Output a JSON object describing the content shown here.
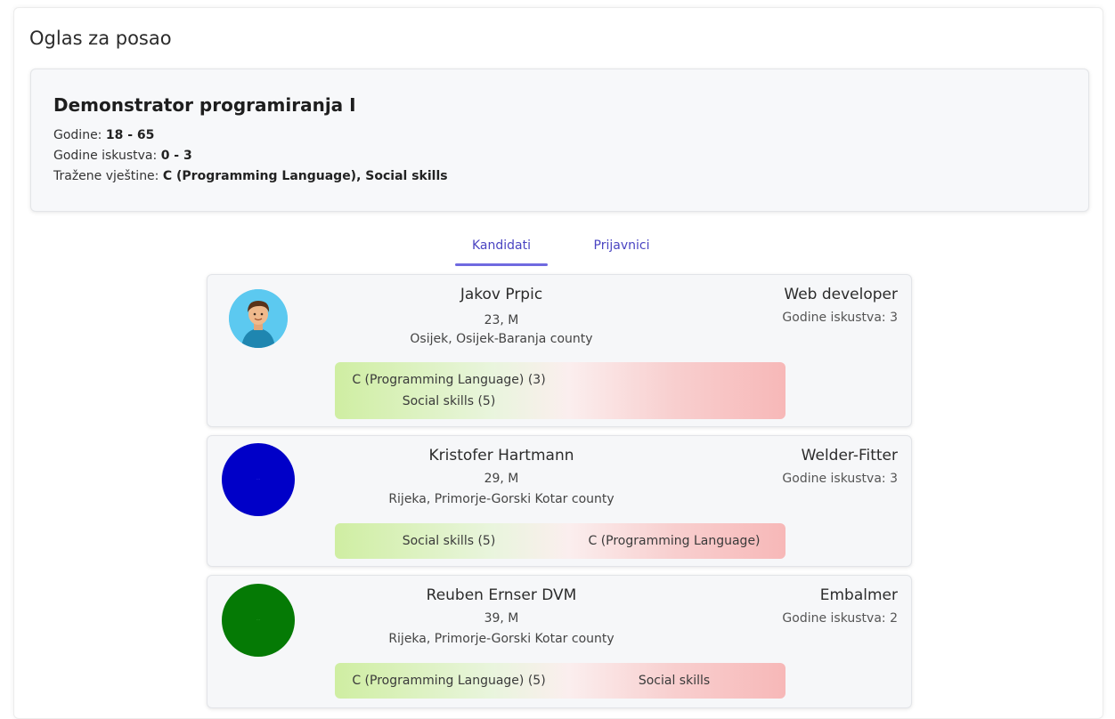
{
  "page": {
    "title": "Oglas za posao"
  },
  "job": {
    "title": "Demonstrator programiranja I",
    "age_label": "Godine:",
    "age_value": "18 - 65",
    "experience_label": "Godine iskustva:",
    "experience_value": "0 - 3",
    "skills_label": "Tražene vještine:",
    "skills_value": "C (Programming Language), Social skills"
  },
  "tabs": [
    {
      "label": "Kandidati",
      "active": true
    },
    {
      "label": "Prijavnici",
      "active": false
    }
  ],
  "candidates": [
    {
      "name": "Jakov Prpic",
      "age_gender": "23, M",
      "location": "Osijek, Osijek-Baranja county",
      "position": "Web developer",
      "experience": "Godine iskustva: 3",
      "avatar": "person-avatar",
      "matched_skills": [
        "C (Programming Language) (3)",
        "Social skills (5)"
      ],
      "missing_skills": []
    },
    {
      "name": "Kristofer Hartmann",
      "age_gender": "29, M",
      "location": "Rijeka, Primorje-Gorski Kotar county",
      "position": "Welder-Fitter",
      "experience": "Godine iskustva: 3",
      "avatar_color": "#0000c8",
      "matched_skills": [
        "Social skills (5)"
      ],
      "missing_skills": [
        "C (Programming Language)"
      ]
    },
    {
      "name": "Reuben Ernser DVM",
      "age_gender": "39, M",
      "location": "Rijeka, Primorje-Gorski Kotar county",
      "position": "Embalmer",
      "experience": "Godine iskustva: 2",
      "avatar_color": "#057a05",
      "matched_skills": [
        "C (Programming Language) (5)"
      ],
      "missing_skills": [
        "Social skills"
      ]
    }
  ]
}
